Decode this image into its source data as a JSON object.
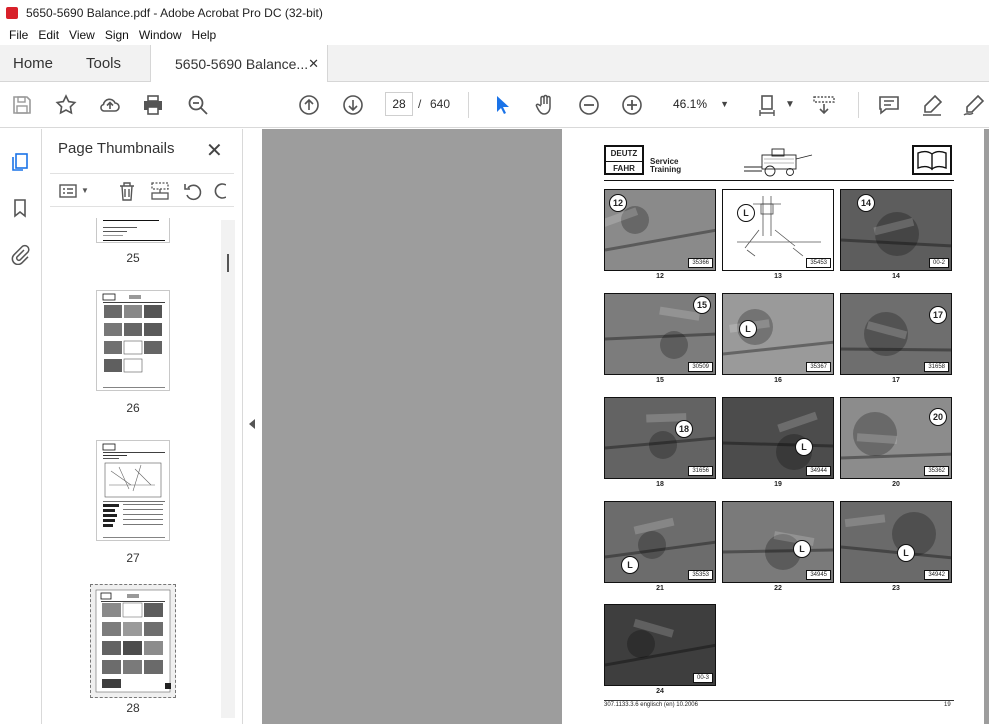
{
  "window": {
    "title": "5650-5690 Balance.pdf - Adobe Acrobat Pro DC (32-bit)"
  },
  "menu": [
    "File",
    "Edit",
    "View",
    "Sign",
    "Window",
    "Help"
  ],
  "tabs": {
    "home": "Home",
    "tools": "Tools",
    "document": "5650-5690 Balance..."
  },
  "toolbar": {
    "current_page": "28",
    "page_separator": "/",
    "total_pages": "640",
    "zoom": "46.1%"
  },
  "thumbnails_panel": {
    "title": "Page Thumbnails",
    "pages": [
      "25",
      "26",
      "27",
      "28"
    ],
    "selected": "28"
  },
  "document_page": {
    "logo_top": "DEUTZ",
    "logo_bottom": "FAHR",
    "service_line1": "Service",
    "service_line2": "Training",
    "photos": [
      {
        "callout": "12",
        "code": "35366",
        "caption": "12",
        "tone": "#8a8a8a"
      },
      {
        "callout": "L",
        "code": "35453",
        "caption": "13",
        "tone": "#ffffff"
      },
      {
        "callout": "14",
        "code": "00-2",
        "caption": "14",
        "tone": "#5d5d5d"
      },
      {
        "callout": "15",
        "code": "30509",
        "caption": "15",
        "tone": "#7c7c7c"
      },
      {
        "callout": "L",
        "code": "35367",
        "caption": "16",
        "tone": "#9a9a9a"
      },
      {
        "callout": "17",
        "code": "31658",
        "caption": "17",
        "tone": "#6e6e6e"
      },
      {
        "callout": "18",
        "code": "31656",
        "caption": "18",
        "tone": "#636363"
      },
      {
        "callout": "L",
        "code": "34944",
        "caption": "19",
        "tone": "#4c4c4c"
      },
      {
        "callout": "20",
        "code": "35362",
        "caption": "20",
        "tone": "#8c8c8c"
      },
      {
        "callout": "L",
        "code": "35353",
        "caption": "21",
        "tone": "#6c6c6c"
      },
      {
        "callout": "L",
        "code": "34945",
        "caption": "22",
        "tone": "#7a7a7a"
      },
      {
        "callout": "L",
        "code": "34942",
        "caption": "23",
        "tone": "#6a6a6a"
      },
      {
        "callout": "",
        "code": "00-3",
        "caption": "24",
        "tone": "#3e3e3e"
      }
    ],
    "footer_left": "307.1133.3.6 englisch (en) 10.2006",
    "footer_right": "19"
  },
  "colors": {
    "acrobat_red": "#d8202a",
    "cursor_blue": "#1a73e8",
    "canvas_gray": "#9d9d9d"
  }
}
